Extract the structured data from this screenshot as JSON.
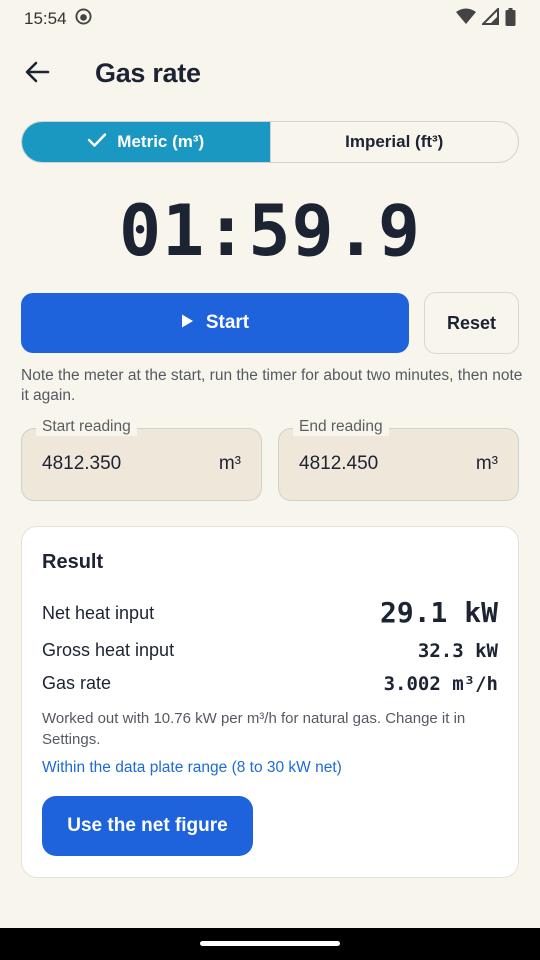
{
  "status_bar": {
    "time": "15:54"
  },
  "app_bar": {
    "title": "Gas rate"
  },
  "units": {
    "metric_label": "Metric (m³)",
    "imperial_label": "Imperial (ft³)",
    "selected": "metric"
  },
  "timer": {
    "display": "01:59.9"
  },
  "controls": {
    "start_label": "Start",
    "reset_label": "Reset"
  },
  "hint": "Note the meter at the start, run the timer for about two minutes, then note it again.",
  "readings": {
    "start": {
      "label": "Start reading",
      "value": "4812.350",
      "unit": "m³"
    },
    "end": {
      "label": "End reading",
      "value": "4812.450",
      "unit": "m³"
    }
  },
  "result": {
    "title": "Result",
    "net_label": "Net heat input",
    "net_value": "29.1 kW",
    "gross_label": "Gross heat input",
    "gross_value": "32.3 kW",
    "rate_label": "Gas rate",
    "rate_value": "3.002 m³/h",
    "note": "Worked out with 10.76 kW per m³/h for natural gas. Change it in Settings.",
    "range_text": "Within the data plate range (8 to 30 kW net)",
    "use_net_label": "Use the net figure"
  },
  "colors": {
    "background": "#f8f5ec",
    "segment_active": "#1a98c2",
    "primary_button": "#1e63dc",
    "link_text": "#1e6ad6"
  }
}
